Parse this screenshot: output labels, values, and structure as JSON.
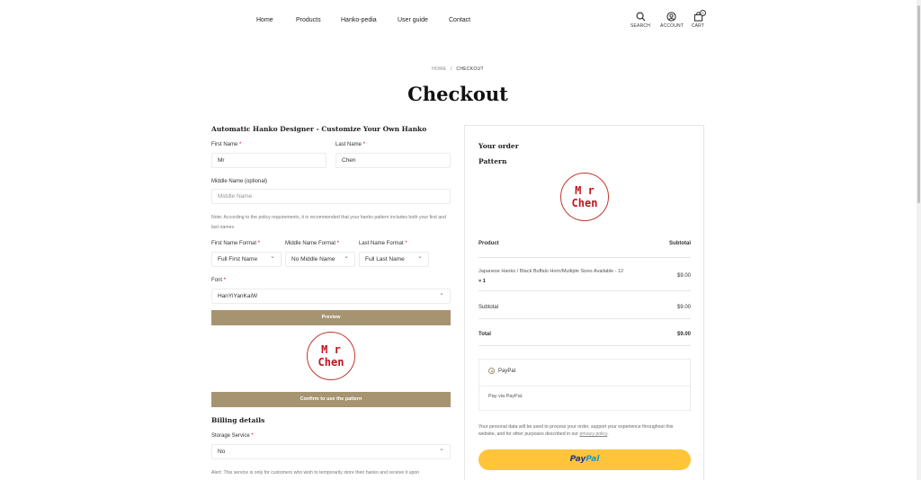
{
  "nav": {
    "items": [
      "Home",
      "Products",
      "Hanko-pedia",
      "User guide",
      "Contact"
    ]
  },
  "header_icons": {
    "search": "SEARCH",
    "account": "ACCOUNT",
    "cart": "CART",
    "cart_count": "0"
  },
  "breadcrumb": {
    "home": "HOME",
    "sep": "/",
    "current": "CHECKOUT"
  },
  "page_title": "Checkout",
  "designer": {
    "title": "Automatic Hanko Designer - Customize Your Own Hanko",
    "first_name_label": "First Name",
    "first_name_value": "Mr",
    "last_name_label": "Last Name",
    "last_name_value": "Chen",
    "middle_name_label": "Middle Name (optional)",
    "middle_name_placeholder": "Middle Name",
    "note": "Note: According to the policy requirements, it is recommended that your hanko pattern includes both your first and last names.",
    "first_format_label": "First Name Format",
    "first_format_value": "Full First Name",
    "middle_format_label": "Middle Name Format",
    "middle_format_value": "No Middle Name",
    "last_format_label": "Last Name Format",
    "last_format_value": "Full Last Name",
    "font_label": "Font",
    "font_value": "HanYiYanKaiW",
    "preview_button": "Preview",
    "stamp_line1": "M r",
    "stamp_line2": "Chen",
    "confirm_button": "Confirm to use the pattern"
  },
  "billing": {
    "title": "Billing details",
    "storage_label": "Storage Service",
    "storage_value": "No",
    "alert": "Alert: This service is only for customers who wish to temporarily store their hanko and receive it upon"
  },
  "order": {
    "title": "Your order",
    "pattern_label": "Pattern",
    "stamp_line1": "M r",
    "stamp_line2": "Chen",
    "col_product": "Product",
    "col_subtotal": "Subtotal",
    "item_name": "Japanese Hanko / Black Buffalo Horn/Multiple Sizes Available - 12",
    "item_qty": "× 1",
    "item_price": "$9.00",
    "subtotal_label": "Subtotal",
    "subtotal_value": "$9.00",
    "total_label": "Total",
    "total_value": "$9.00",
    "payment_method": "PayPal",
    "payment_desc": "Pay via PayPal.",
    "privacy_text": "Your personal data will be used to process your order, support your experience throughout this website, and for other purposes described in our",
    "privacy_link": "privacy policy",
    "privacy_end": ".",
    "paypal_btn_1": "Pay",
    "paypal_btn_2": "Pal"
  },
  "colors": {
    "accent_brown": "#a69471",
    "stamp_red": "#c0141e",
    "paypal_yellow": "#ffc439"
  }
}
